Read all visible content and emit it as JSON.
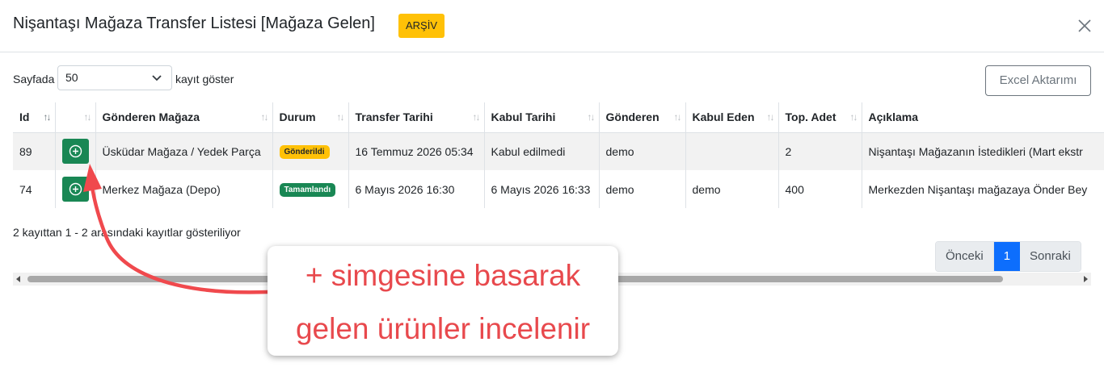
{
  "modal": {
    "title": "Nişantaşı Mağaza Transfer Listesi [Mağaza Gelen]",
    "badge": "ARŞİV"
  },
  "controls": {
    "length_prefix": "Sayfada",
    "length_value": "50",
    "length_suffix": "kayıt göster",
    "excel_label": "Excel Aktarımı"
  },
  "table": {
    "columns": [
      "Id",
      "",
      "Gönderen Mağaza",
      "Durum",
      "Transfer Tarihi",
      "Kabul Tarihi",
      "Gönderen",
      "Kabul Eden",
      "Top. Adet",
      "Açıklama"
    ],
    "rows": [
      {
        "id": "89",
        "from_store": "Üsküdar Mağaza / Yedek Parça",
        "status": "Gönderildi",
        "status_color": "#ffc107",
        "transfer_date": "16 Temmuz 2026 05:34",
        "accept_date": "Kabul edilmedi",
        "sender": "demo",
        "receiver": "",
        "total": "2",
        "description": "Nişantaşı Mağazanın İstedikleri (Mart ekstr"
      },
      {
        "id": "74",
        "from_store": "Merkez Mağaza (Depo)",
        "status": "Tamamlandı",
        "status_color": "#198754",
        "transfer_date": "6 Mayıs 2026 16:30",
        "accept_date": "6 Mayıs 2026 16:33",
        "sender": "demo",
        "receiver": "demo",
        "total": "400",
        "description": "Merkezden Nişantaşı mağazaya Önder Bey"
      }
    ]
  },
  "footer": {
    "info": "2 kayıttan 1 - 2 arasındaki kayıtlar gösteriliyor",
    "prev_label": "Önceki",
    "current_page": "1",
    "next_label": "Sonraki"
  },
  "annotation": {
    "line1": "+ simgesine basarak",
    "line2": "gelen ürünler incelenir",
    "color": "#e8494d"
  },
  "icons": {
    "close": "close-icon",
    "expand": "plus-circle-icon",
    "select": "chevron-down-icon",
    "sort": "sort-arrows-icon"
  }
}
